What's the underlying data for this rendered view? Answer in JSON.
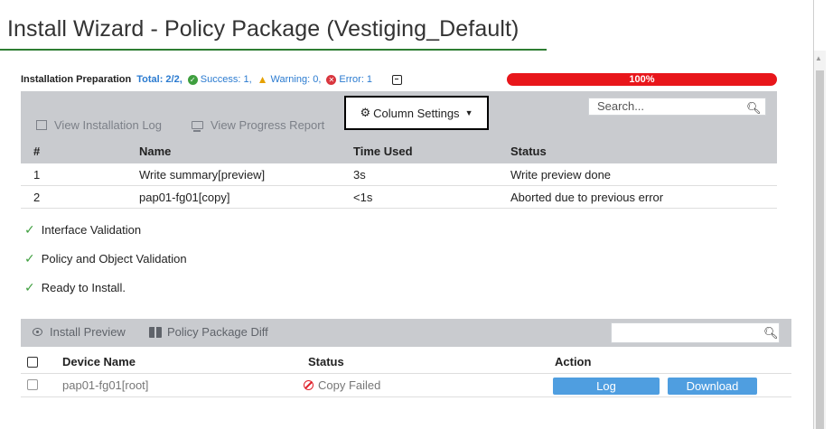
{
  "window": {
    "title": "Install Wizard - Policy Package (Vestiging_Default)"
  },
  "prep": {
    "title": "Installation Preparation",
    "total": "Total: 2/2,",
    "success": "Success: 1,",
    "warning": "Warning: 0,",
    "error": "Error: 1",
    "progress_label": "100%",
    "progress_value": 1.0
  },
  "toolbar1": {
    "view_log": "View Installation Log",
    "view_report": "View Progress Report",
    "column_settings": "Column Settings",
    "search_placeholder": "Search..."
  },
  "table1": {
    "columns": [
      "#",
      "Name",
      "Time Used",
      "Status"
    ],
    "rows": [
      {
        "num": "1",
        "name": "Write summary[preview]",
        "time": "3s",
        "status": "Write preview done"
      },
      {
        "num": "2",
        "name": "pap01-fg01[copy]",
        "time": "<1s",
        "status": "Aborted due to previous error"
      }
    ]
  },
  "checks": [
    "Interface Validation",
    "Policy and Object Validation",
    "Ready to Install."
  ],
  "toolbar2": {
    "install_preview": "Install Preview",
    "policy_diff": "Policy Package Diff",
    "search_placeholder": ""
  },
  "table2": {
    "columns": [
      "Device Name",
      "Status",
      "Action"
    ],
    "rows": [
      {
        "device": "pap01-fg01[root]",
        "status": "Copy Failed",
        "log": "Log",
        "download": "Download"
      }
    ]
  },
  "colors": {
    "accent": "#2e7d32",
    "progress": "#e8161b",
    "button": "#4f9ee0",
    "error": "#e0202a"
  }
}
